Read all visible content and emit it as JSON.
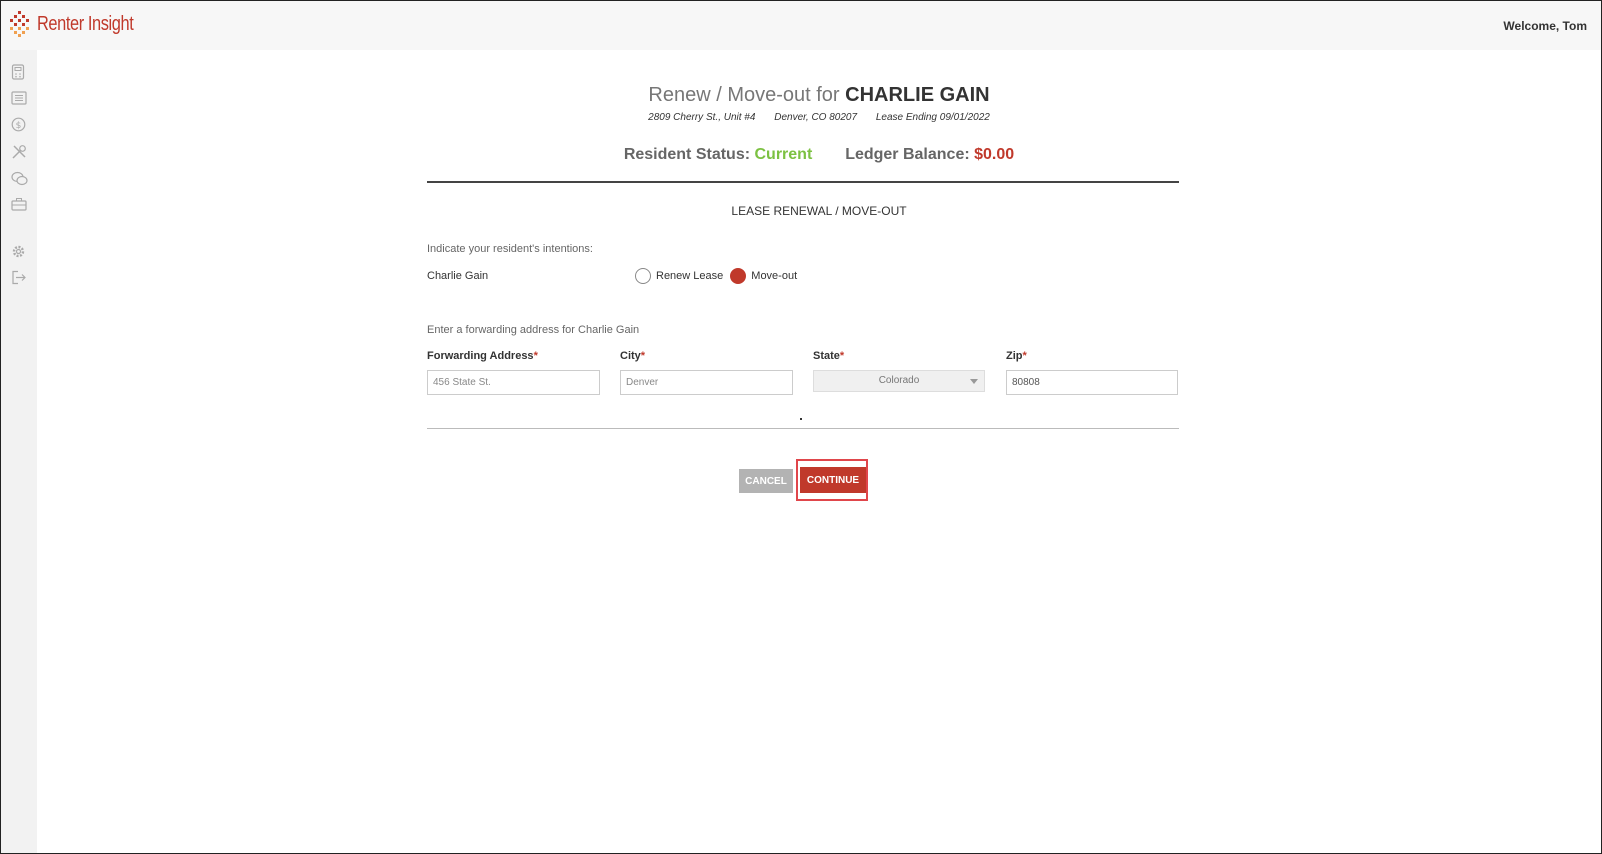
{
  "header": {
    "brand": "Renter Insight",
    "welcome": "Welcome, Tom"
  },
  "sidebar": {
    "items": [
      {
        "icon": "calculator-icon"
      },
      {
        "icon": "list-icon"
      },
      {
        "icon": "dollar-icon"
      },
      {
        "icon": "tools-icon"
      },
      {
        "icon": "chat-icon"
      },
      {
        "icon": "briefcase-icon"
      },
      {
        "icon": "gear-icon"
      },
      {
        "icon": "logout-icon"
      }
    ]
  },
  "page": {
    "title_prefix": "Renew / Move-out for ",
    "title_name": "CHARLIE GAIN",
    "address": "2809 Cherry St., Unit #4",
    "city_state": "Denver, CO 80207",
    "lease_end": "Lease Ending 09/01/2022",
    "status_label": "Resident Status: ",
    "status_value": "Current",
    "balance_label": "Ledger Balance: ",
    "balance_value": "$0.00"
  },
  "form": {
    "section_title": "LEASE RENEWAL / MOVE-OUT",
    "intent_prompt": "Indicate your resident's intentions:",
    "resident_name": "Charlie Gain",
    "options": [
      {
        "label": "Renew Lease",
        "checked": false
      },
      {
        "label": "Move-out",
        "checked": true
      }
    ],
    "forwarding_prompt": "Enter a forwarding address for Charlie Gain",
    "fields": {
      "address": {
        "label": "Forwarding Address",
        "value": "456 State St."
      },
      "city": {
        "label": "City",
        "value": "Denver"
      },
      "state": {
        "label": "State",
        "value": "Colorado"
      },
      "zip": {
        "label": "Zip",
        "value": "80808"
      }
    },
    "required_mark": "*",
    "cancel_label": "CANCEL",
    "continue_label": "CONTINUE"
  },
  "colors": {
    "accent": "#c0392b",
    "status_green": "#7cc142",
    "highlight": "#e0464b"
  }
}
